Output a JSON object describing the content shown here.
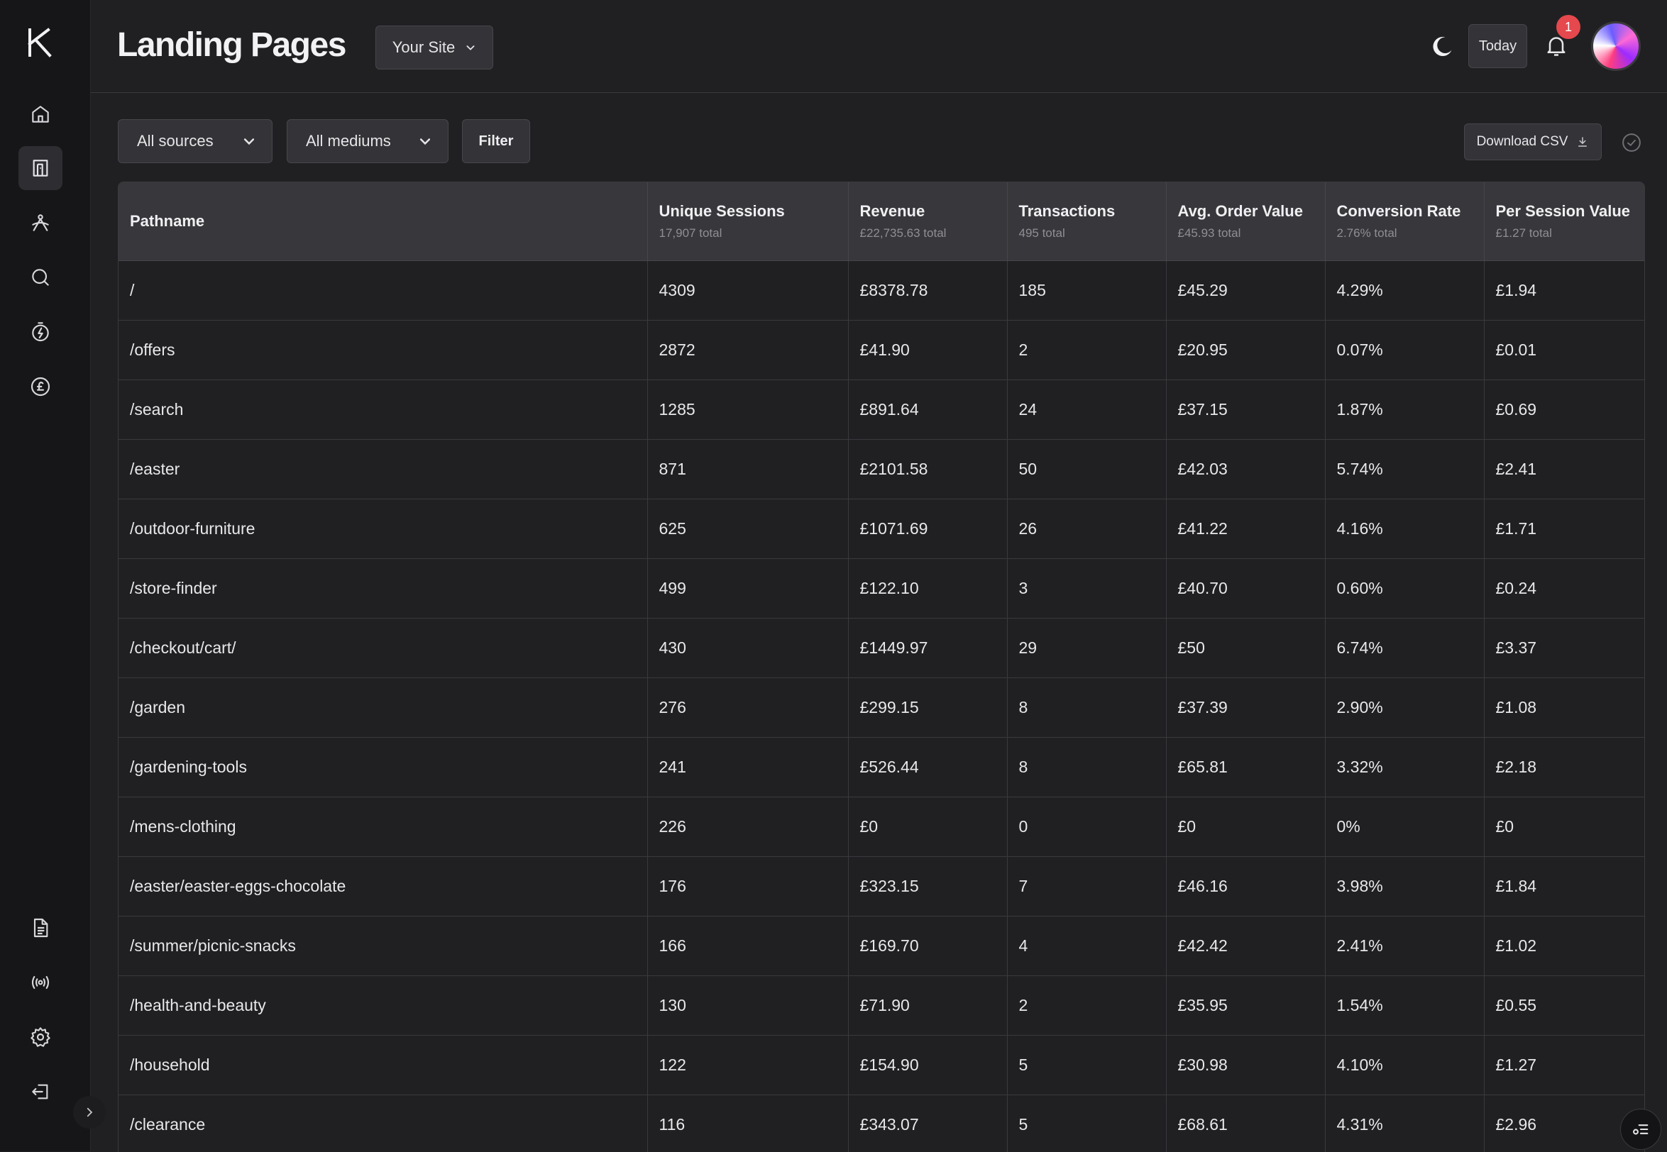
{
  "brand": {
    "logo_letter": "K"
  },
  "header": {
    "title": "Landing Pages",
    "site_select": "Your Site",
    "today_label": "Today",
    "notification_count": "1"
  },
  "sidebar": {
    "top_items": [
      {
        "icon": "home-icon",
        "active": false
      },
      {
        "icon": "landing-pages-icon",
        "active": true
      },
      {
        "icon": "acquisition-icon",
        "active": false
      },
      {
        "icon": "search-icon",
        "active": false
      },
      {
        "icon": "speed-icon",
        "active": false
      },
      {
        "icon": "revenue-icon",
        "active": false
      }
    ],
    "bottom_items": [
      {
        "icon": "report-icon"
      },
      {
        "icon": "broadcast-icon"
      },
      {
        "icon": "settings-icon"
      },
      {
        "icon": "logout-icon"
      }
    ]
  },
  "toolbar": {
    "sources": "All sources",
    "mediums": "All mediums",
    "filter_label": "Filter",
    "download_label": "Download CSV"
  },
  "table": {
    "columns": [
      {
        "title": "Pathname",
        "total": ""
      },
      {
        "title": "Unique Sessions",
        "total": "17,907 total"
      },
      {
        "title": "Revenue",
        "total": "£22,735.63 total"
      },
      {
        "title": "Transactions",
        "total": "495 total"
      },
      {
        "title": "Avg. Order Value",
        "total": "£45.93 total"
      },
      {
        "title": "Conversion Rate",
        "total": "2.76% total"
      },
      {
        "title": "Per Session Value",
        "total": "£1.27 total"
      }
    ],
    "rows": [
      [
        "/",
        "4309",
        "£8378.78",
        "185",
        "£45.29",
        "4.29%",
        "£1.94"
      ],
      [
        "/offers",
        "2872",
        "£41.90",
        "2",
        "£20.95",
        "0.07%",
        "£0.01"
      ],
      [
        "/search",
        "1285",
        "£891.64",
        "24",
        "£37.15",
        "1.87%",
        "£0.69"
      ],
      [
        "/easter",
        "871",
        "£2101.58",
        "50",
        "£42.03",
        "5.74%",
        "£2.41"
      ],
      [
        "/outdoor-furniture",
        "625",
        "£1071.69",
        "26",
        "£41.22",
        "4.16%",
        "£1.71"
      ],
      [
        "/store-finder",
        "499",
        "£122.10",
        "3",
        "£40.70",
        "0.60%",
        "£0.24"
      ],
      [
        "/checkout/cart/",
        "430",
        "£1449.97",
        "29",
        "£50",
        "6.74%",
        "£3.37"
      ],
      [
        "/garden",
        "276",
        "£299.15",
        "8",
        "£37.39",
        "2.90%",
        "£1.08"
      ],
      [
        "/gardening-tools",
        "241",
        "£526.44",
        "8",
        "£65.81",
        "3.32%",
        "£2.18"
      ],
      [
        "/mens-clothing",
        "226",
        "£0",
        "0",
        "£0",
        "0%",
        "£0"
      ],
      [
        "/easter/easter-eggs-chocolate",
        "176",
        "£323.15",
        "7",
        "£46.16",
        "3.98%",
        "£1.84"
      ],
      [
        "/summer/picnic-snacks",
        "166",
        "£169.70",
        "4",
        "£42.42",
        "2.41%",
        "£1.02"
      ],
      [
        "/health-and-beauty",
        "130",
        "£71.90",
        "2",
        "£35.95",
        "1.54%",
        "£0.55"
      ],
      [
        "/household",
        "122",
        "£154.90",
        "5",
        "£30.98",
        "4.10%",
        "£1.27"
      ],
      [
        "/clearance",
        "116",
        "£343.07",
        "5",
        "£68.61",
        "4.31%",
        "£2.96"
      ]
    ]
  },
  "colors": {
    "background": "#202022",
    "sidebar": "#161618",
    "header_row": "#38383c",
    "badge": "#e5484d"
  }
}
